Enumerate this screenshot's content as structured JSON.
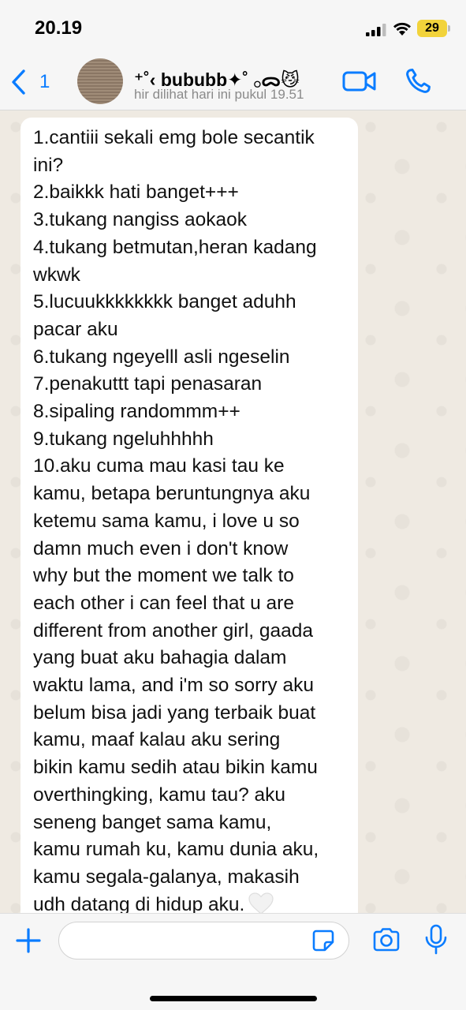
{
  "status_bar": {
    "time": "20.19",
    "battery": "29"
  },
  "header": {
    "back_count": "1",
    "contact_name": "⁺˚‹ bububb✦˚ 𓂂ᯅ😼",
    "contact_status": "hir dilihat hari ini pukul 19.51"
  },
  "message": {
    "lines": [
      "1.cantiii sekali emg bole secantik",
      "ini?",
      "2.baikkk hati banget+++",
      "3.tukang nangiss aokaok",
      "4.tukang betmutan,heran kadang",
      "wkwk",
      "5.lucuukkkkkkkk banget aduhh",
      "pacar aku",
      "6.tukang ngeyelll asli ngeselin",
      "7.penakuttt tapi penasaran",
      "8.sipaling randommm++",
      "9.tukang ngeluhhhhh",
      "10.aku cuma mau kasi tau ke",
      "kamu, betapa beruntungnya aku",
      "ketemu sama kamu, i love u so",
      "damn much even i don't know",
      "why but the moment we talk to",
      "each other i can feel that u are",
      "different from another girl, gaada",
      "yang buat aku bahagia dalam",
      "waktu lama, and i'm so sorry aku",
      "belum bisa jadi yang terbaik buat",
      "kamu, maaf kalau aku sering",
      "bikin kamu sedih atau bikin kamu",
      "overthingking, kamu tau? aku",
      "seneng banget sama kamu,",
      "kamu rumah ku, kamu dunia aku,",
      "kamu segala-galanya, makasih",
      "udh datang di hidup aku."
    ]
  },
  "input": {
    "placeholder": "",
    "value": ""
  },
  "colors": {
    "accent": "#0a7cff",
    "bubble": "#ffffff",
    "chat_bg": "#efeae2",
    "bar_bg": "#f6f6f6"
  },
  "icons": [
    "signal-icon",
    "wifi-icon",
    "back-chevron-icon",
    "video-call-icon",
    "phone-icon",
    "heart-icon",
    "scroll-down-icon",
    "plus-icon",
    "sticker-icon",
    "camera-icon",
    "mic-icon"
  ]
}
